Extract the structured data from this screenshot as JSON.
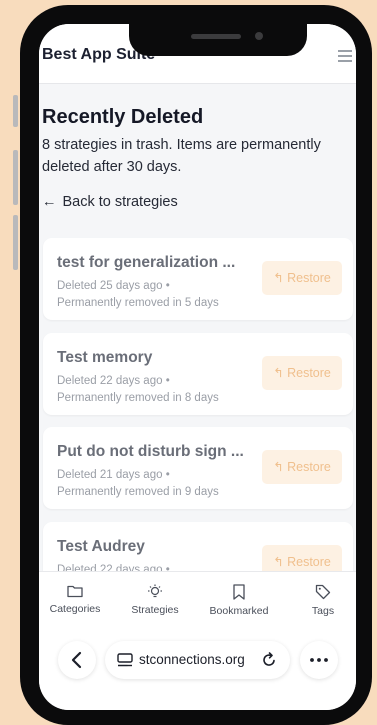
{
  "app": {
    "title": "Best App Suite",
    "menu_icon": "hamburger-menu-icon"
  },
  "page": {
    "title": "Recently Deleted",
    "subtitle": "8 strategies in trash. Items are permanently deleted after 30 days.",
    "back_arrow": "←",
    "back_label": "Back to strategies"
  },
  "items": [
    {
      "title": "test for generalization ...",
      "deleted": "Deleted 25 days ago •",
      "removal": "Permanently removed in 5 days",
      "action": "Restore"
    },
    {
      "title": "Test memory",
      "deleted": "Deleted 22 days ago •",
      "removal": "Permanently removed in 8 days",
      "action": "Restore"
    },
    {
      "title": "Put do not disturb sign ...",
      "deleted": "Deleted 21 days ago •",
      "removal": "Permanently removed in 9 days",
      "action": "Restore"
    },
    {
      "title": "Test Audrey",
      "deleted": "Deleted 22 days ago •",
      "removal": "",
      "action": "Restore"
    }
  ],
  "restore_icon": "↰",
  "tabs": [
    {
      "label": "Categories",
      "icon": "folder-icon"
    },
    {
      "label": "Strategies",
      "icon": "lightbulb-icon"
    },
    {
      "label": "Bookmarked",
      "icon": "bookmark-icon"
    },
    {
      "label": "Tags",
      "icon": "tag-icon"
    }
  ],
  "browser": {
    "url": "stconnections.org",
    "back_glyph": "‹",
    "more_glyph": "•••"
  },
  "colors": {
    "accent": "#f0c08e",
    "accent_bg": "#fdf1e3",
    "background": "#f8dcbd"
  }
}
